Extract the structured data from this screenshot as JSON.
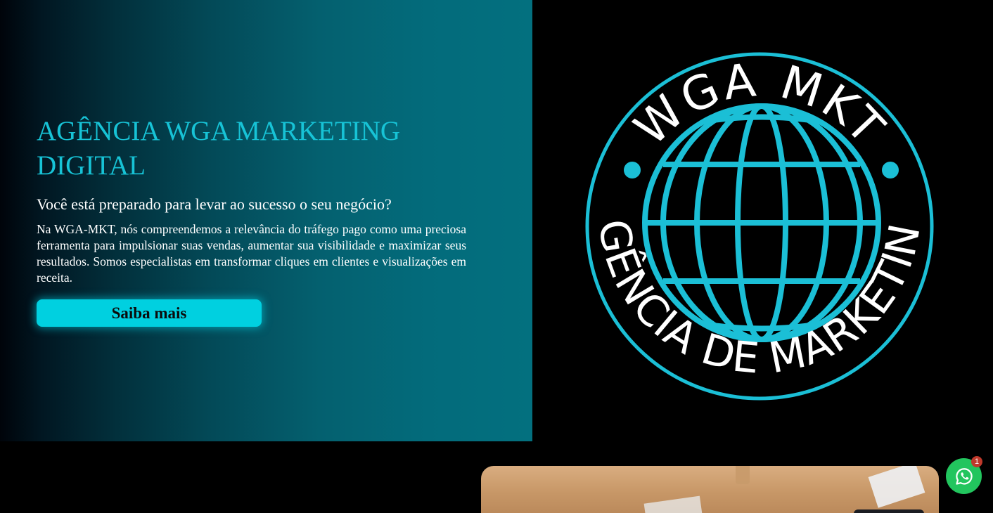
{
  "hero": {
    "title": "AGÊNCIA WGA MARKETING DIGITAL",
    "subtitle": "Você está preparado para levar ao sucesso o seu negócio?",
    "body": "Na WGA-MKT, nós compreendemos a relevância do tráfego pago como uma preciosa ferramenta para impulsionar suas vendas, aumentar sua visibilidade e maximizar seus resultados. Somos especialistas em transformar cliques em clientes e visualizações em receita.",
    "cta_label": "Saiba mais"
  },
  "logo": {
    "top_text": "WGA MKT",
    "bottom_text": "AGÊNCIA DE MARKETING",
    "icon": "globe-icon",
    "accent_color": "#1bbfd6"
  },
  "whatsapp": {
    "icon": "whatsapp-icon",
    "badge_count": "1",
    "color": "#22c55e"
  },
  "colors": {
    "accent": "#17c3d6",
    "button": "#00d0e0",
    "background": "#000000"
  }
}
